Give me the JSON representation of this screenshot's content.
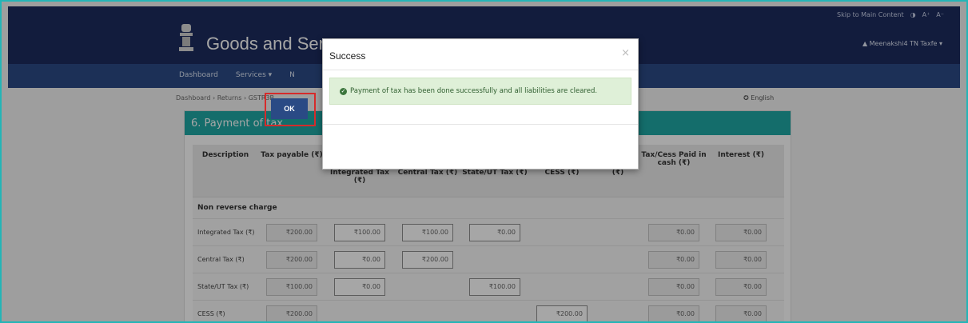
{
  "header": {
    "brand": "Goods and Serv",
    "skip_link": "Skip to Main Content",
    "contrast_icon": "◑",
    "font_up": "A⁺",
    "font_down": "A⁻",
    "user": "▲ Meenakshi4 TN Taxfe ▾"
  },
  "nav": {
    "items": [
      "Dashboard",
      "Services ▾",
      "N"
    ]
  },
  "breadcrumb": "Dashboard › Returns › GSTR3B",
  "language": "✪ English",
  "card": {
    "title": "6. Payment of tax",
    "headers": [
      "Description",
      "Tax payable (₹)",
      "Integrated Tax (₹)",
      "Central Tax (₹)",
      "State/UT Tax (₹)",
      "CESS (₹)",
      "(₹)",
      "Tax/Cess Paid in cash (₹)",
      "Interest (₹)"
    ],
    "section": "Non reverse charge",
    "rows": [
      {
        "label": "Integrated Tax (₹)",
        "payable": "₹200.00",
        "igst": "₹100.00",
        "cgst": "₹100.00",
        "sgst": "₹0.00",
        "cess": "",
        "cash": "₹0.00",
        "interest": "₹0.00"
      },
      {
        "label": "Central Tax (₹)",
        "payable": "₹200.00",
        "igst": "₹0.00",
        "cgst": "₹200.00",
        "sgst": "",
        "cess": "",
        "cash": "₹0.00",
        "interest": "₹0.00"
      },
      {
        "label": "State/UT Tax (₹)",
        "payable": "₹100.00",
        "igst": "₹0.00",
        "cgst": "",
        "sgst": "₹100.00",
        "cess": "",
        "cash": "₹0.00",
        "interest": "₹0.00"
      },
      {
        "label": "CESS (₹)",
        "payable": "₹200.00",
        "igst": "",
        "cgst": "",
        "sgst": "",
        "cess": "₹200.00",
        "cash": "₹0.00",
        "interest": "₹0.00"
      }
    ]
  },
  "modal": {
    "title": "Success",
    "close": "×",
    "message": "Payment of tax has been done successfully and all liabilities are cleared.",
    "ok_label": "OK"
  }
}
